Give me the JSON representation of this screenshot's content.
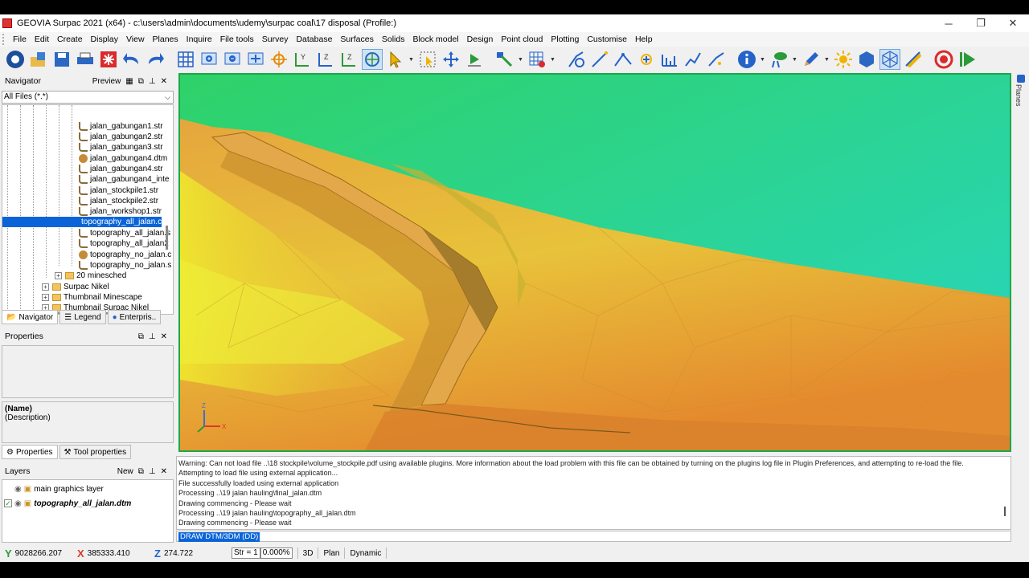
{
  "window": {
    "title": "GEOVIA Surpac 2021 (x64) - c:\\users\\admin\\documents\\udemy\\surpac coal\\17 disposal (Profile:)",
    "minimize": "─",
    "maximize": "❐",
    "close": "✕"
  },
  "menu": [
    "File",
    "Edit",
    "Create",
    "Display",
    "View",
    "Planes",
    "Inquire",
    "File tools",
    "Survey",
    "Database",
    "Surfaces",
    "Solids",
    "Block model",
    "Design",
    "Point cloud",
    "Plotting",
    "Customise",
    "Help"
  ],
  "navigator": {
    "title": "Navigator",
    "preview": "Preview",
    "filter": "All Files (*.*)",
    "items": [
      {
        "label": "jalan_gabungan1.str",
        "type": "str"
      },
      {
        "label": "jalan_gabungan2.str",
        "type": "str"
      },
      {
        "label": "jalan_gabungan3.str",
        "type": "str"
      },
      {
        "label": "jalan_gabungan4.dtm",
        "type": "dtm"
      },
      {
        "label": "jalan_gabungan4.str",
        "type": "str"
      },
      {
        "label": "jalan_gabungan4_inte",
        "type": "str"
      },
      {
        "label": "jalan_stockpile1.str",
        "type": "str"
      },
      {
        "label": "jalan_stockpile2.str",
        "type": "str"
      },
      {
        "label": "jalan_workshop1.str",
        "type": "str"
      },
      {
        "label": "topography_all_jalan.c",
        "type": "dtm"
      },
      {
        "label": "topography_all_jalan.s",
        "type": "str"
      },
      {
        "label": "topography_all_jalan2",
        "type": "str"
      },
      {
        "label": "topography_no_jalan.c",
        "type": "dtm"
      },
      {
        "label": "topography_no_jalan.s",
        "type": "str"
      }
    ],
    "selected_index": 9,
    "folders": [
      "20 minesched",
      "Surpac Nikel",
      "Thumbnail Minescape",
      "Thumbnail Surpac Nikel"
    ],
    "tabs": [
      "Navigator",
      "Legend",
      "Enterpris.."
    ]
  },
  "properties": {
    "title": "Properties",
    "name": "(Name)",
    "description": "(Description)",
    "tabs": [
      "Properties",
      "Tool properties"
    ]
  },
  "layers": {
    "title": "Layers",
    "new": "New",
    "items": [
      {
        "label": "main graphics layer",
        "checked": false,
        "active": false
      },
      {
        "label": "topography_all_jalan.dtm",
        "checked": true,
        "active": true
      }
    ]
  },
  "planes_tab": "Planes",
  "axes": {
    "z": "Z",
    "x": "X"
  },
  "messages": [
    "Warning: Can not load file ..\\18 stockpile\\volume_stockpile.pdf using available plugins.  More information about the load problem with this file can be obtained by turning on the plugins log file in Plugin Preferences, and attempting to re-load the file.",
    "Attempting to load file using external application...",
    "File successfully loaded using external application",
    "Processing ..\\19 jalan hauling\\final_jalan.dtm",
    "Drawing commencing - Please wait",
    "Processing ..\\19 jalan hauling\\topography_all_jalan.dtm",
    "Drawing commencing - Please wait"
  ],
  "command": "DRAW DTM/3DM (DD)",
  "status": {
    "y": "9028266.207",
    "x": "385333.410",
    "z": "274.722",
    "str_label": "Str = 1",
    "percent": "0.000%",
    "mode3d": "3D",
    "plan": "Plan",
    "dynamic": "Dynamic"
  },
  "colors": {
    "viewport_border": "#1aa84a",
    "selection": "#0a64d8",
    "bg_green": "#2fd27a",
    "bg_teal": "#2ad8b0",
    "surface_orange": "#e8a23a",
    "surface_yellow": "#e6e030"
  }
}
